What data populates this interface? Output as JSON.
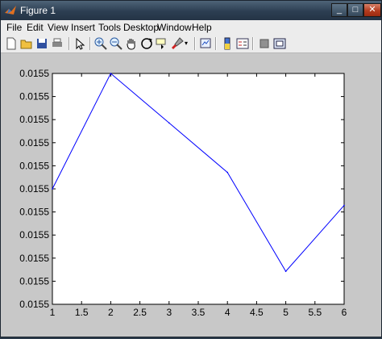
{
  "window": {
    "title": "Figure 1"
  },
  "titlebar_buttons": {
    "minimize": "_",
    "maximize": "□",
    "close": "✕"
  },
  "menu": [
    "File",
    "Edit",
    "View",
    "Insert",
    "Tools",
    "Desktop",
    "Window",
    "Help"
  ],
  "toolbar": {
    "tools": [
      "new-figure-icon",
      "open-file-icon",
      "save-icon",
      "print-icon",
      "edit-plot-icon",
      "zoom-in-icon",
      "zoom-out-icon",
      "pan-icon",
      "rotate-3d-icon",
      "data-cursor-icon",
      "brush-icon",
      "link-icon",
      "colorbar-icon",
      "legend-icon",
      "hide-plot-tools-icon",
      "show-plot-tools-icon"
    ]
  },
  "chart_data": {
    "type": "line",
    "x": [
      1,
      2,
      3,
      4,
      5,
      6
    ],
    "y": [
      0.0155,
      0.0155,
      0.0155,
      0.0155,
      0.0155,
      0.0155
    ],
    "relative_levels": [
      3.5,
      7,
      5.5,
      4,
      1,
      3
    ],
    "xlim": [
      1,
      6
    ],
    "x_ticks": [
      "1",
      "1.5",
      "2",
      "2.5",
      "3",
      "3.5",
      "4",
      "4.5",
      "5",
      "5.5",
      "6"
    ],
    "y_ticks": [
      "0.0155",
      "0.0155",
      "0.0155",
      "0.0155",
      "0.0155",
      "0.0155",
      "0.0155",
      "0.0155",
      "0.0155",
      "0.0155",
      "0.0155"
    ],
    "line_color": "#0000ff",
    "grid": false,
    "title": "",
    "xlabel": "",
    "ylabel": ""
  }
}
